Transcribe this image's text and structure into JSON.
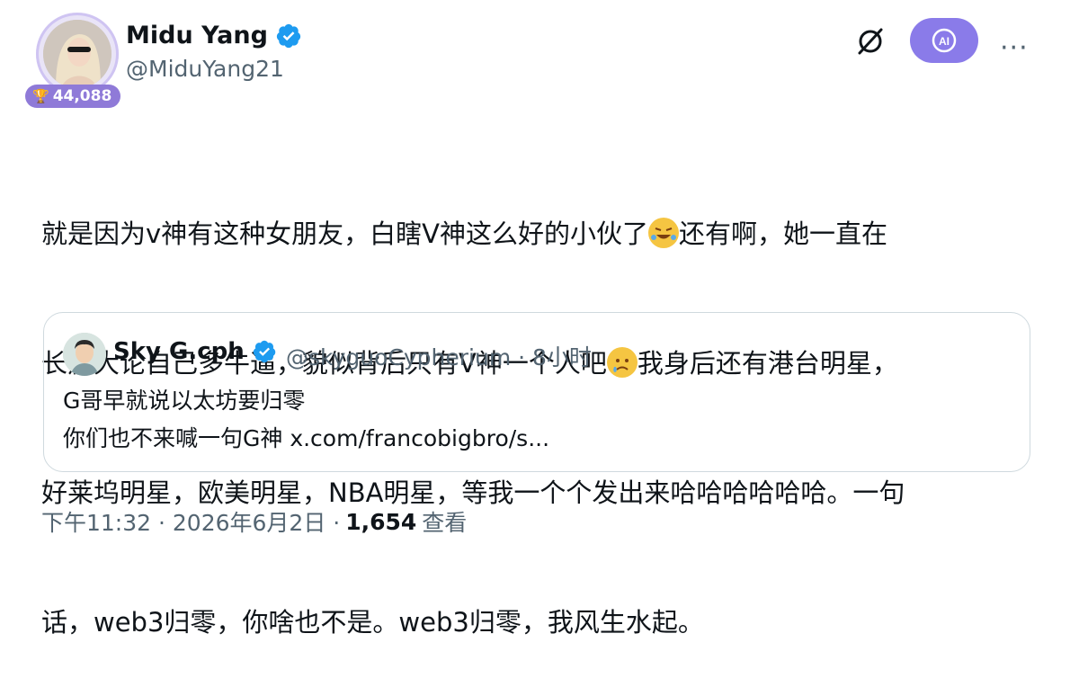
{
  "author": {
    "name": "Midu Yang",
    "handle": "@MiduYang21",
    "score": "44,088"
  },
  "toolbar": {
    "ai_label": "AI"
  },
  "tweet": {
    "lines": [
      "就是因为v神有这种女朋友，白瞎V神这么好的小伙了",
      "还有啊，她一直在",
      "长篇大论自己多牛逼，貌似背后只有V神一个人吧",
      "我身后还有港台明星，",
      "好莱坞明星，欧美明星，NBA明星，等我一个个发出来哈哈哈哈哈哈。一句",
      "话，web3归零，你啥也不是。web3归零，我风生水起。"
    ]
  },
  "quote": {
    "name": "Sky G.cph",
    "meta": "@skyguoCypherium · 8小时",
    "line1": "G哥早就说以太坊要归零",
    "line2": "你们也不来喊一句G神 x.com/francobigbro/s..."
  },
  "footer": {
    "time": "下午11:32 · 2026年6月2日 ·",
    "views": "1,654",
    "views_label": "查看"
  }
}
